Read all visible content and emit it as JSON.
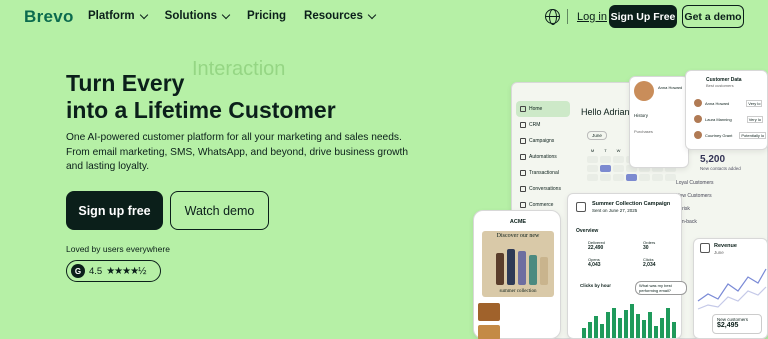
{
  "nav": {
    "logo": "Brevo",
    "links": [
      "Platform",
      "Solutions",
      "Pricing",
      "Resources"
    ],
    "login": "Log in",
    "signup": "Sign Up Free",
    "demo": "Get a demo"
  },
  "hero": {
    "line1": "Turn Every",
    "ghost_word": "Interaction",
    "line2": "into a Lifetime Customer",
    "description": "One AI-powered customer platform for all your marketing and sales needs. From email marketing, SMS, WhatsApp, and beyond, drive business growth and lasting loyalty.",
    "cta_primary": "Sign up free",
    "cta_secondary": "Watch demo",
    "loved": "Loved by users everywhere",
    "rating": "4.5",
    "rating_stars": "★★★★½"
  },
  "mock": {
    "sidebar": [
      "Home",
      "CRM",
      "Campaigns",
      "Automations",
      "Transactional",
      "Conversations",
      "Commerce"
    ],
    "hello": "Hello Adrian",
    "month": "June",
    "weekdays": [
      "M",
      "T",
      "W",
      "T",
      "F",
      "S",
      "S"
    ],
    "profile_name": "Anna Howard",
    "profile_history": "History",
    "profile_purchases": "Purchases",
    "customer_data_title": "Customer Data",
    "customer_data_sub": "Best customers",
    "customers": [
      "Anna Howard",
      "Laura Manning",
      "Courtney Grant"
    ],
    "customer_tags": [
      "Very lo",
      "Very lo",
      "Potentially lo"
    ],
    "stat_value": "5,200",
    "stat_label": "New contacts added",
    "low_rows": [
      "Loyal Customers",
      "New Customers",
      "At risk",
      "Win-back"
    ],
    "campaign_title": "Summer Collection Campaign",
    "campaign_date": "Sent on June 27, 2025",
    "overview": "Overview",
    "metrics": [
      {
        "label": "Delivered",
        "value": "22,490"
      },
      {
        "label": "Orders",
        "value": "30"
      },
      {
        "label": "Opens",
        "value": "4,043"
      },
      {
        "label": "Clicks",
        "value": "2,034"
      }
    ],
    "clicks_by_hour": "Clicks by hour",
    "tooltip": "What was my best performing email?",
    "acme": "ACME",
    "banner_top": "Discover our new",
    "banner_bottom": "summer collection",
    "revenue_title": "Revenue",
    "revenue_month": "June",
    "new_customers_label": "New customers",
    "new_customers_value": "$2,495"
  }
}
